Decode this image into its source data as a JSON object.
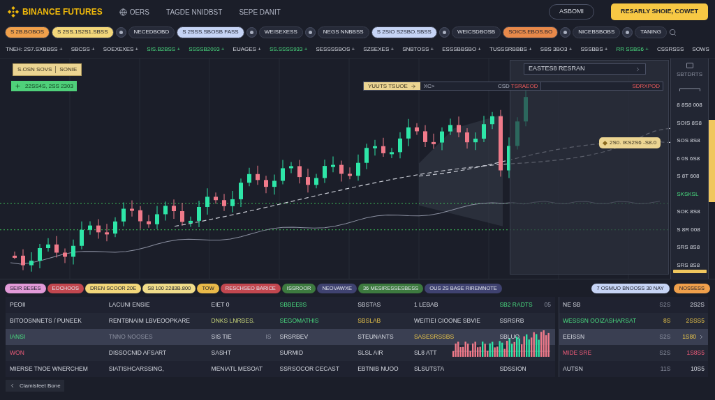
{
  "header": {
    "brand": "BINANCE FUTURES",
    "nav": [
      {
        "label": "OERS",
        "kind": "globe"
      },
      {
        "label": "TAGDE NNIDBST",
        "kind": "plain"
      },
      {
        "label": "SEPE DANIT",
        "kind": "plain"
      }
    ],
    "buttons": [
      {
        "label": "ASBOMI",
        "kind": "outline"
      },
      {
        "label": "RESARLY SHOIE, COWET",
        "kind": "primary"
      }
    ]
  },
  "markets": [
    {
      "kind": "pill",
      "label": "S 2B.BOBOS",
      "color": "#f0a04b"
    },
    {
      "kind": "pill",
      "label": "S 2SS.1S2S1.SBSS",
      "color": "#f3d77a"
    },
    {
      "kind": "coin"
    },
    {
      "kind": "pill",
      "label": "NECEDBOBD",
      "color": "#262a38"
    },
    {
      "kind": "pill",
      "label": "S 2SSS.SBOSB FASS",
      "color": "#c6d4f5"
    },
    {
      "kind": "coin"
    },
    {
      "kind": "pill",
      "label": "WEISEXESS",
      "color": "#262a38"
    },
    {
      "kind": "coin"
    },
    {
      "kind": "pill",
      "label": "NEGS NNBBSS",
      "color": "#262a38"
    },
    {
      "kind": "pill",
      "label": "S 2SIO S2SBO.SBSS",
      "color": "#c6d4f5"
    },
    {
      "kind": "coin"
    },
    {
      "kind": "pill",
      "label": "WEICSDBOSB",
      "color": "#262a38"
    },
    {
      "kind": "pill",
      "label": "SOICS.EBOS.BO",
      "color": "#e8894a"
    },
    {
      "kind": "coin"
    },
    {
      "kind": "pill",
      "label": "NICEBSBOBS",
      "color": "#262a38"
    },
    {
      "kind": "coin"
    },
    {
      "kind": "pill",
      "label": "TANING",
      "color": "#262a38"
    },
    {
      "kind": "search"
    }
  ],
  "ticker": [
    {
      "text": "TNEH: 2S7.SXBBSS +",
      "kind": "plain"
    },
    {
      "text": "SBCSS +",
      "kind": "plain"
    },
    {
      "text": "SOEXEXES +",
      "kind": "plain"
    },
    {
      "text": "SIS.B2BSS +",
      "kind": "up"
    },
    {
      "text": "SSSSB2093 +",
      "kind": "up"
    },
    {
      "text": "EUAGES +",
      "kind": "plain"
    },
    {
      "text": "SS.SSSS933 +",
      "kind": "up"
    },
    {
      "text": "SESSSSBOS +",
      "kind": "plain"
    },
    {
      "text": "SZSEXES +",
      "kind": "plain"
    },
    {
      "text": "SNBTOSS +",
      "kind": "plain"
    },
    {
      "text": "ESSSBBSBO +",
      "kind": "plain"
    },
    {
      "text": "TUSSSRBBBS +",
      "kind": "plain"
    },
    {
      "text": "SBS 3BO3 +",
      "kind": "plain"
    },
    {
      "text": "SSSBBS +",
      "kind": "plain"
    },
    {
      "text": "RR SSBS6 +",
      "kind": "up"
    },
    {
      "text": "CSSRSSS",
      "kind": "plain"
    },
    {
      "text": "SOWS",
      "kind": "plain"
    }
  ],
  "chart": {
    "badges": [
      {
        "kind": "info",
        "text": "S.OSN SOVS",
        "tag": "SONIE"
      },
      {
        "kind": "buy",
        "text": "22SS4S, 2SS 2303"
      }
    ],
    "order": {
      "label": "YUUTS TSUOE",
      "field": "XC>",
      "tag": "CSD",
      "value": "TSRAEOD",
      "side": "SDRXPOD"
    },
    "panel": {
      "title": "EASTES8 RESRAN"
    },
    "tooltip": "2S0. IKS2S6 -S8.0",
    "axis": {
      "title": "SBTDRTS",
      "labels": [
        {
          "text": "8 8S8 008",
          "kind": "price"
        },
        {
          "text": "SOIS 8S8",
          "kind": "price"
        },
        {
          "text": "SOS 8S8",
          "kind": "price"
        },
        {
          "text": "6 0S 6S8",
          "kind": "price"
        },
        {
          "text": "S 8T 608",
          "kind": "price"
        },
        {
          "text": "SKSKSL",
          "kind": "mark"
        },
        {
          "text": "SOK 8S8",
          "kind": "price"
        },
        {
          "text": "S 8R 008",
          "kind": "price"
        },
        {
          "text": "SRS 8S8",
          "kind": "price"
        },
        {
          "text": "SRS 8S8",
          "kind": "price"
        }
      ]
    }
  },
  "filters": [
    {
      "label": "SEIR BESES",
      "color": "#e29ad8"
    },
    {
      "label": "EOCHOOS",
      "color": "#c2474f"
    },
    {
      "label": "DREN SCOOR 20E",
      "color": "#f3d77a"
    },
    {
      "label": "S8 100 2283B.800",
      "color": "#f0dc8a"
    },
    {
      "label": "TOW",
      "color": "#e9b949"
    },
    {
      "label": "RESCHSEO BARICE",
      "color": "#c2474f"
    },
    {
      "label": "ISSROOR",
      "color": "#3d7a3f"
    },
    {
      "label": "NEOVAWXE",
      "color": "#3f4270"
    },
    {
      "label": "36 MESIRESSESBESS",
      "color": "#3d7a3f"
    },
    {
      "label": "OUS 2S BASE RIREMNOTE",
      "color": "#3f4270"
    }
  ],
  "summary_chips": [
    {
      "label": "7 OSMUO BNOOSS 30 NAY",
      "color": "#c6d4f5"
    },
    {
      "label": "NOSSESS",
      "color": "#f0a04b"
    }
  ],
  "rows": [
    {
      "selected": false,
      "cells": [
        {
          "text": "PEOII",
          "kind": "plain"
        },
        {
          "text": "LACUNI ENSIE",
          "kind": "plain"
        },
        {
          "text": "EIET 0",
          "kind": "plain"
        },
        {
          "text": "SBBEE8S",
          "kind": "up"
        },
        {
          "text": "SBSTAS",
          "kind": "plain"
        },
        {
          "text": "1 LEBAB",
          "kind": "plain"
        },
        {
          "text": "SB2 RADTS",
          "kind": "up",
          "aside": "05"
        }
      ],
      "right": [
        {
          "text": "NE SB",
          "kind": "plain"
        },
        {
          "text": "S2S",
          "kind": "dim"
        },
        {
          "text": "2S2S",
          "kind": "plain"
        }
      ]
    },
    {
      "selected": false,
      "cells": [
        {
          "text": "BITOOSNNETS / PUNEEK",
          "kind": "plain"
        },
        {
          "text": "RENTBNAIM LBVEOOPKARE",
          "kind": "plain"
        },
        {
          "text": "DNKS LNRBES.",
          "kind": "lime"
        },
        {
          "text": "SEGOMATHIS",
          "kind": "up"
        },
        {
          "text": "SBSLAB",
          "kind": "warn"
        },
        {
          "text": "WEITIEI CIOONE SBVIE",
          "kind": "plain"
        },
        {
          "text": "SSRSRB",
          "kind": "plain"
        }
      ],
      "right": [
        {
          "text": "WESSSN OOIZASHARSAT",
          "kind": "up"
        },
        {
          "text": "8S",
          "kind": "warn"
        },
        {
          "text": "2SSS5",
          "kind": "warn"
        }
      ]
    },
    {
      "selected": true,
      "cells": [
        {
          "text": "IANSI",
          "kind": "up"
        },
        {
          "text": "TNNO NOOSES",
          "kind": "dim"
        },
        {
          "text": "SIS TIE",
          "kind": "plain",
          "aside": "IS"
        },
        {
          "text": "SRSRBEV",
          "kind": "plain"
        },
        {
          "text": "STEUNANTS",
          "kind": "plain"
        },
        {
          "text": "SASESRSSBS",
          "kind": "warn"
        },
        {
          "text": "SBLUO",
          "kind": "plain"
        }
      ],
      "right": [
        {
          "text": "EEISSN",
          "kind": "plain"
        },
        {
          "text": "S2S",
          "kind": "dim"
        },
        {
          "text": "1S80",
          "kind": "warn"
        }
      ]
    },
    {
      "selected": false,
      "cells": [
        {
          "text": "WON",
          "kind": "down"
        },
        {
          "text": "DISSOCNID AFSART",
          "kind": "plain"
        },
        {
          "text": "SASHT",
          "kind": "plain"
        },
        {
          "text": "SURMID",
          "kind": "plain"
        },
        {
          "text": "SLSL AIR",
          "kind": "plain"
        },
        {
          "text": "SL8 ATT",
          "kind": "plain"
        }
      ],
      "right": [
        {
          "text": "MIDE SRE",
          "kind": "down"
        },
        {
          "text": "S2S",
          "kind": "dim"
        },
        {
          "text": "1S8S5",
          "kind": "down"
        }
      ]
    },
    {
      "selected": false,
      "cells": [
        {
          "text": "MIERSE TNOE WNERCHEM",
          "kind": "plain"
        },
        {
          "text": "SIATISHCARSSING,",
          "kind": "plain"
        },
        {
          "text": "MENIATL MESOAT",
          "kind": "plain"
        },
        {
          "text": "SSRSOCOR CECAST",
          "kind": "plain"
        },
        {
          "text": "EBTNIB NUOO",
          "kind": "plain"
        },
        {
          "text": "SLSUTSTA",
          "kind": "plain"
        },
        {
          "text": "SDSSION",
          "kind": "plain"
        }
      ],
      "right": [
        {
          "text": "AUTSN",
          "kind": "plain"
        },
        {
          "text": "11S",
          "kind": "dim"
        },
        {
          "text": "10S5",
          "kind": "plain"
        }
      ]
    }
  ],
  "footer": {
    "label": "Clamisfeet Bone"
  }
}
